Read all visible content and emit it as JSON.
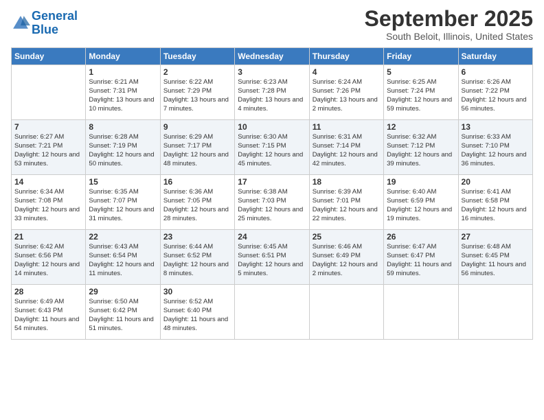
{
  "logo": {
    "text_general": "General",
    "text_blue": "Blue"
  },
  "header": {
    "month": "September 2025",
    "location": "South Beloit, Illinois, United States"
  },
  "weekdays": [
    "Sunday",
    "Monday",
    "Tuesday",
    "Wednesday",
    "Thursday",
    "Friday",
    "Saturday"
  ],
  "weeks": [
    [
      {
        "day": "",
        "sunrise": "",
        "sunset": "",
        "daylight": ""
      },
      {
        "day": "1",
        "sunrise": "Sunrise: 6:21 AM",
        "sunset": "Sunset: 7:31 PM",
        "daylight": "Daylight: 13 hours and 10 minutes."
      },
      {
        "day": "2",
        "sunrise": "Sunrise: 6:22 AM",
        "sunset": "Sunset: 7:29 PM",
        "daylight": "Daylight: 13 hours and 7 minutes."
      },
      {
        "day": "3",
        "sunrise": "Sunrise: 6:23 AM",
        "sunset": "Sunset: 7:28 PM",
        "daylight": "Daylight: 13 hours and 4 minutes."
      },
      {
        "day": "4",
        "sunrise": "Sunrise: 6:24 AM",
        "sunset": "Sunset: 7:26 PM",
        "daylight": "Daylight: 13 hours and 2 minutes."
      },
      {
        "day": "5",
        "sunrise": "Sunrise: 6:25 AM",
        "sunset": "Sunset: 7:24 PM",
        "daylight": "Daylight: 12 hours and 59 minutes."
      },
      {
        "day": "6",
        "sunrise": "Sunrise: 6:26 AM",
        "sunset": "Sunset: 7:22 PM",
        "daylight": "Daylight: 12 hours and 56 minutes."
      }
    ],
    [
      {
        "day": "7",
        "sunrise": "Sunrise: 6:27 AM",
        "sunset": "Sunset: 7:21 PM",
        "daylight": "Daylight: 12 hours and 53 minutes."
      },
      {
        "day": "8",
        "sunrise": "Sunrise: 6:28 AM",
        "sunset": "Sunset: 7:19 PM",
        "daylight": "Daylight: 12 hours and 50 minutes."
      },
      {
        "day": "9",
        "sunrise": "Sunrise: 6:29 AM",
        "sunset": "Sunset: 7:17 PM",
        "daylight": "Daylight: 12 hours and 48 minutes."
      },
      {
        "day": "10",
        "sunrise": "Sunrise: 6:30 AM",
        "sunset": "Sunset: 7:15 PM",
        "daylight": "Daylight: 12 hours and 45 minutes."
      },
      {
        "day": "11",
        "sunrise": "Sunrise: 6:31 AM",
        "sunset": "Sunset: 7:14 PM",
        "daylight": "Daylight: 12 hours and 42 minutes."
      },
      {
        "day": "12",
        "sunrise": "Sunrise: 6:32 AM",
        "sunset": "Sunset: 7:12 PM",
        "daylight": "Daylight: 12 hours and 39 minutes."
      },
      {
        "day": "13",
        "sunrise": "Sunrise: 6:33 AM",
        "sunset": "Sunset: 7:10 PM",
        "daylight": "Daylight: 12 hours and 36 minutes."
      }
    ],
    [
      {
        "day": "14",
        "sunrise": "Sunrise: 6:34 AM",
        "sunset": "Sunset: 7:08 PM",
        "daylight": "Daylight: 12 hours and 33 minutes."
      },
      {
        "day": "15",
        "sunrise": "Sunrise: 6:35 AM",
        "sunset": "Sunset: 7:07 PM",
        "daylight": "Daylight: 12 hours and 31 minutes."
      },
      {
        "day": "16",
        "sunrise": "Sunrise: 6:36 AM",
        "sunset": "Sunset: 7:05 PM",
        "daylight": "Daylight: 12 hours and 28 minutes."
      },
      {
        "day": "17",
        "sunrise": "Sunrise: 6:38 AM",
        "sunset": "Sunset: 7:03 PM",
        "daylight": "Daylight: 12 hours and 25 minutes."
      },
      {
        "day": "18",
        "sunrise": "Sunrise: 6:39 AM",
        "sunset": "Sunset: 7:01 PM",
        "daylight": "Daylight: 12 hours and 22 minutes."
      },
      {
        "day": "19",
        "sunrise": "Sunrise: 6:40 AM",
        "sunset": "Sunset: 6:59 PM",
        "daylight": "Daylight: 12 hours and 19 minutes."
      },
      {
        "day": "20",
        "sunrise": "Sunrise: 6:41 AM",
        "sunset": "Sunset: 6:58 PM",
        "daylight": "Daylight: 12 hours and 16 minutes."
      }
    ],
    [
      {
        "day": "21",
        "sunrise": "Sunrise: 6:42 AM",
        "sunset": "Sunset: 6:56 PM",
        "daylight": "Daylight: 12 hours and 14 minutes."
      },
      {
        "day": "22",
        "sunrise": "Sunrise: 6:43 AM",
        "sunset": "Sunset: 6:54 PM",
        "daylight": "Daylight: 12 hours and 11 minutes."
      },
      {
        "day": "23",
        "sunrise": "Sunrise: 6:44 AM",
        "sunset": "Sunset: 6:52 PM",
        "daylight": "Daylight: 12 hours and 8 minutes."
      },
      {
        "day": "24",
        "sunrise": "Sunrise: 6:45 AM",
        "sunset": "Sunset: 6:51 PM",
        "daylight": "Daylight: 12 hours and 5 minutes."
      },
      {
        "day": "25",
        "sunrise": "Sunrise: 6:46 AM",
        "sunset": "Sunset: 6:49 PM",
        "daylight": "Daylight: 12 hours and 2 minutes."
      },
      {
        "day": "26",
        "sunrise": "Sunrise: 6:47 AM",
        "sunset": "Sunset: 6:47 PM",
        "daylight": "Daylight: 11 hours and 59 minutes."
      },
      {
        "day": "27",
        "sunrise": "Sunrise: 6:48 AM",
        "sunset": "Sunset: 6:45 PM",
        "daylight": "Daylight: 11 hours and 56 minutes."
      }
    ],
    [
      {
        "day": "28",
        "sunrise": "Sunrise: 6:49 AM",
        "sunset": "Sunset: 6:43 PM",
        "daylight": "Daylight: 11 hours and 54 minutes."
      },
      {
        "day": "29",
        "sunrise": "Sunrise: 6:50 AM",
        "sunset": "Sunset: 6:42 PM",
        "daylight": "Daylight: 11 hours and 51 minutes."
      },
      {
        "day": "30",
        "sunrise": "Sunrise: 6:52 AM",
        "sunset": "Sunset: 6:40 PM",
        "daylight": "Daylight: 11 hours and 48 minutes."
      },
      {
        "day": "",
        "sunrise": "",
        "sunset": "",
        "daylight": ""
      },
      {
        "day": "",
        "sunrise": "",
        "sunset": "",
        "daylight": ""
      },
      {
        "day": "",
        "sunrise": "",
        "sunset": "",
        "daylight": ""
      },
      {
        "day": "",
        "sunrise": "",
        "sunset": "",
        "daylight": ""
      }
    ]
  ]
}
